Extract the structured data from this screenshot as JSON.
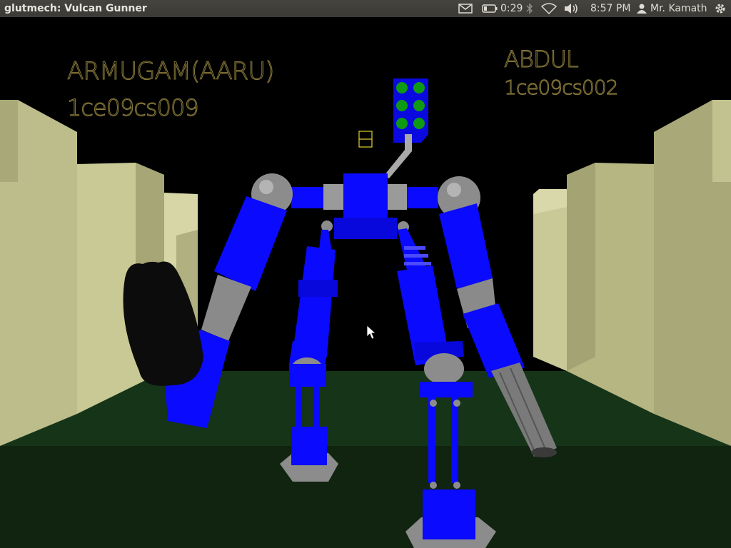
{
  "window": {
    "title": "glutmech: Vulcan Gunner"
  },
  "indicators": {
    "battery_time": "0:29",
    "clock": "8:57 PM",
    "user": "Mr. Kamath"
  },
  "hud": {
    "left_name": "ARMUGAM(AARU)",
    "left_id": "1ce09cs009",
    "right_name": "ABDUL",
    "right_id": "1ce09cs002"
  },
  "colors": {
    "robot_blue": "#0a0aff",
    "floor": "#0f2a12",
    "wall": "#b8b884",
    "joint": "#8c8c8c"
  }
}
